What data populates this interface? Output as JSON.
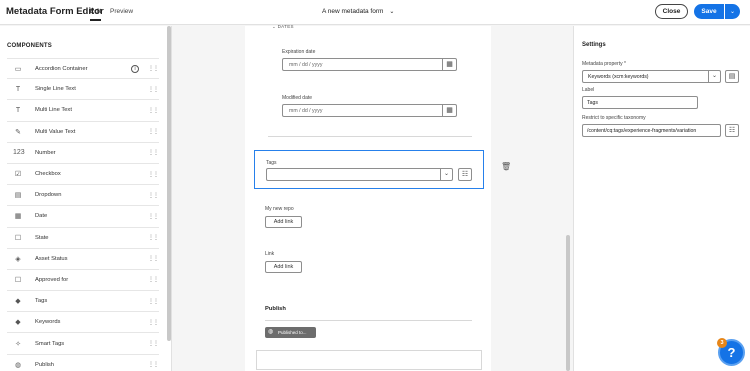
{
  "header": {
    "app_title": "Metadata Form Editor",
    "tabs": [
      {
        "label": "Edit"
      },
      {
        "label": "Preview"
      }
    ],
    "form_title": "A new metadata form",
    "close_label": "Close",
    "save_label": "Save"
  },
  "components": {
    "heading": "COMPONENTS",
    "items": [
      {
        "label": "Accordion Container",
        "icon": "accordion-icon",
        "glyph": "▭"
      },
      {
        "label": "Single Line Text",
        "icon": "text-icon",
        "glyph": "T"
      },
      {
        "label": "Multi Line Text",
        "icon": "text-multi-icon",
        "glyph": "T"
      },
      {
        "label": "Multi Value Text",
        "icon": "multi-value-icon",
        "glyph": "✎"
      },
      {
        "label": "Number",
        "icon": "number-icon",
        "glyph": "123"
      },
      {
        "label": "Checkbox",
        "icon": "checkbox-icon",
        "glyph": "☑"
      },
      {
        "label": "Dropdown",
        "icon": "dropdown-icon",
        "glyph": "▤"
      },
      {
        "label": "Date",
        "icon": "date-icon",
        "glyph": "▦"
      },
      {
        "label": "State",
        "icon": "state-icon",
        "glyph": "☐"
      },
      {
        "label": "Asset Status",
        "icon": "asset-status-icon",
        "glyph": "◈"
      },
      {
        "label": "Approved for",
        "icon": "approved-icon",
        "glyph": "☐"
      },
      {
        "label": "Tags",
        "icon": "tag-icon",
        "glyph": "◆"
      },
      {
        "label": "Keywords",
        "icon": "keywords-icon",
        "glyph": "◆"
      },
      {
        "label": "Smart Tags",
        "icon": "smart-tags-icon",
        "glyph": "✧"
      },
      {
        "label": "Publish",
        "icon": "publish-icon",
        "glyph": "◍"
      }
    ]
  },
  "canvas": {
    "dates_header": "DATES",
    "expiration_label": "Expiration date",
    "modified_label": "Modified date",
    "date_placeholder": "mm / dd / yyyy",
    "tags_label": "Tags",
    "repo_label": "My new repo",
    "link_label": "Link",
    "add_link_label": "Add link",
    "publish_title": "Publish",
    "published_chip": "Published to..."
  },
  "settings": {
    "title": "Settings",
    "metadata_property_label": "Metadata property",
    "required_mark": "*",
    "metadata_property_value": "Keywords (xcm:keywords)",
    "label_label": "Label",
    "label_value": "Tags",
    "taxonomy_label": "Restrict to specific taxonomy",
    "taxonomy_value": "/content/cq:tags/experience-fragments/variation"
  },
  "help": {
    "badge_count": "3",
    "glyph": "?"
  },
  "colors": {
    "accent": "#1473e6",
    "selection": "#2680eb",
    "badge": "#e68619"
  }
}
